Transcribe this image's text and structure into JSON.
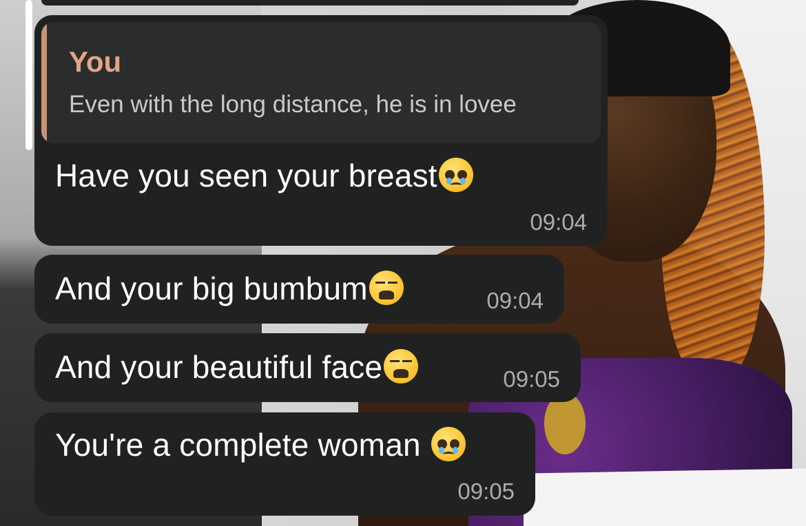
{
  "reply": {
    "author": "You",
    "text": "Even with the long distance, he is in lovee"
  },
  "messages": [
    {
      "text": "Have you seen your breast",
      "emoji": "pleading-face-icon",
      "time": "09:04"
    },
    {
      "text": "And your big bumbum",
      "emoji": "weary-face-icon",
      "time": "09:04"
    },
    {
      "text": "And your beautiful face",
      "emoji": "weary-face-icon",
      "time": "09:05"
    },
    {
      "text": "You're a complete woman ",
      "emoji": "pleading-face-icon",
      "time": "09:05"
    }
  ],
  "colors": {
    "bubble": "#202221",
    "quote_bar": "#c99276",
    "quote_author": "#e2a585",
    "timestamp": "#a9adab"
  }
}
